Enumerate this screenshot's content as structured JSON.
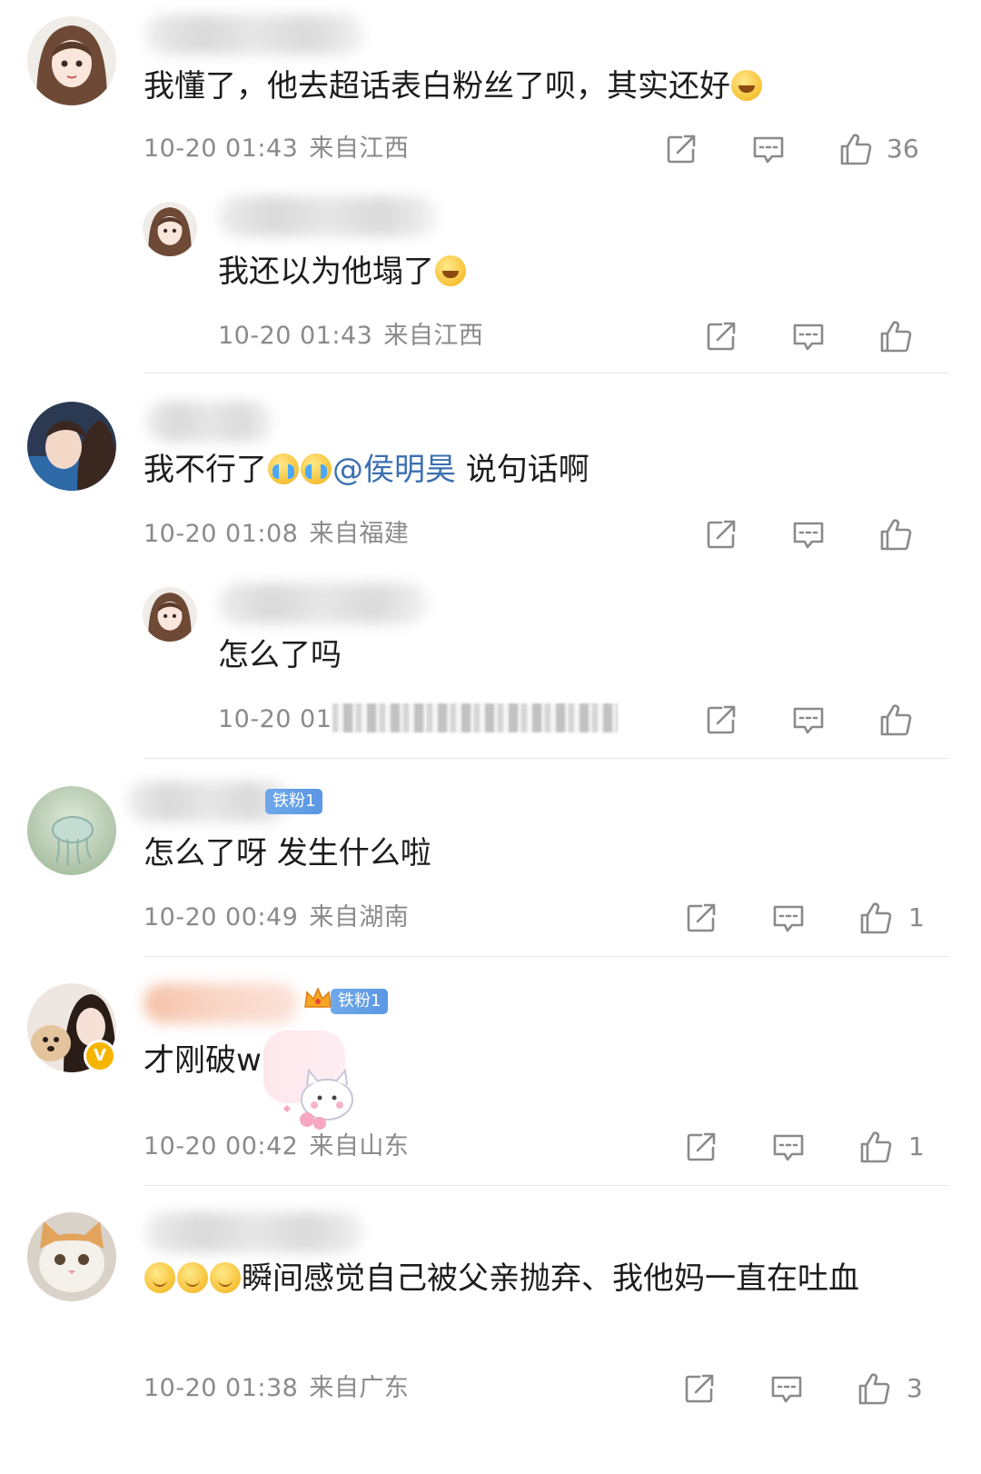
{
  "comments": [
    {
      "text_before": "我懂了，他去超话表白粉丝了呗，其实还好",
      "time": "10-20 01:43",
      "location": "来自江西",
      "likes": "36",
      "replies": [
        {
          "text_before": "我还以为他塌了",
          "time": "10-20 01:43",
          "location": "来自江西",
          "likes": ""
        }
      ]
    },
    {
      "text_before": "我不行了",
      "mention": "@侯明昊",
      "text_after": " 说句话啊",
      "time": "10-20 01:08",
      "location": "来自福建",
      "likes": "",
      "replies": [
        {
          "text_before": "怎么了吗",
          "time": "10-20 01",
          "location": "",
          "likes": ""
        }
      ]
    },
    {
      "badge": "铁粉1",
      "text_before": "怎么了呀 发生什么啦",
      "time": "10-20 00:49",
      "location": "来自湖南",
      "likes": "1"
    },
    {
      "badge": "铁粉1",
      "verified": "V",
      "text_before": "才刚破w",
      "time": "10-20 00:42",
      "location": "来自山东",
      "likes": "1"
    },
    {
      "text_after": "瞬间感觉自己被父亲抛弃、我他妈一直在吐血",
      "time": "10-20 01:38",
      "location": "来自广东",
      "likes": "3"
    }
  ],
  "icons": {
    "share": "share-icon",
    "comment": "comment-icon",
    "like": "like-icon"
  },
  "colors": {
    "mention": "#3a6fb0",
    "badge": "#5b97e3",
    "meta": "#8a8a8a"
  }
}
